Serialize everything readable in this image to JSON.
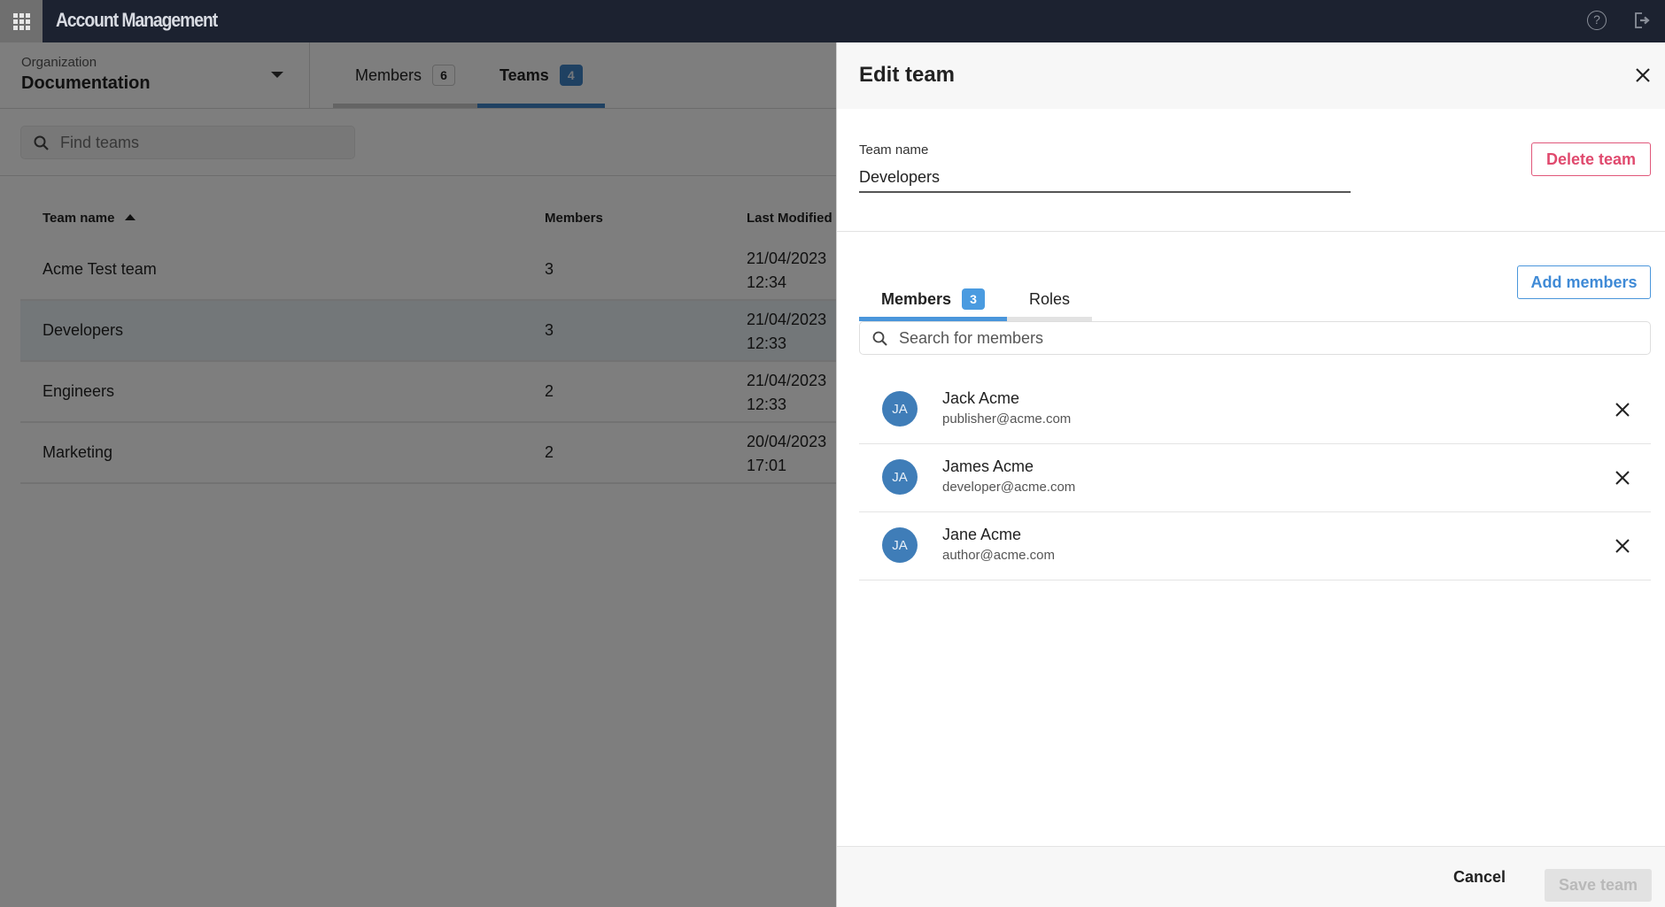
{
  "app": {
    "title": "Account Management",
    "icons": {
      "apps": "apps-grid-icon",
      "help": "help-icon",
      "logout": "logout-icon"
    },
    "help_glyph": "?"
  },
  "organization": {
    "label": "Organization",
    "value": "Documentation"
  },
  "main_tabs": [
    {
      "label": "Members",
      "count": "6",
      "active": false
    },
    {
      "label": "Teams",
      "count": "4",
      "active": true
    }
  ],
  "teams_search": {
    "placeholder": "Find teams",
    "value": ""
  },
  "teams_table": {
    "columns": [
      "Team name",
      "Members",
      "Last Modified"
    ],
    "sort": {
      "column": "Team name",
      "direction": "ascending"
    },
    "rows": [
      {
        "name": "Acme Test team",
        "members": "3",
        "date": "21/04/2023",
        "time": "12:34",
        "selected": false
      },
      {
        "name": "Developers",
        "members": "3",
        "date": "21/04/2023",
        "time": "12:33",
        "selected": true
      },
      {
        "name": "Engineers",
        "members": "2",
        "date": "21/04/2023",
        "time": "12:33",
        "selected": false
      },
      {
        "name": "Marketing",
        "members": "2",
        "date": "20/04/2023",
        "time": "17:01",
        "selected": false
      }
    ]
  },
  "drawer": {
    "title": "Edit team",
    "team_name_label": "Team name",
    "team_name_value": "Developers",
    "delete_label": "Delete team",
    "tabs": [
      {
        "label": "Members",
        "count": "3",
        "active": true
      },
      {
        "label": "Roles",
        "active": false
      }
    ],
    "add_members_label": "Add members",
    "member_search_placeholder": "Search for members",
    "members": [
      {
        "initials": "JA",
        "name": "Jack Acme",
        "email": "publisher@acme.com"
      },
      {
        "initials": "JA",
        "name": "James Acme",
        "email": "developer@acme.com"
      },
      {
        "initials": "JA",
        "name": "Jane Acme",
        "email": "author@acme.com"
      }
    ],
    "cancel_label": "Cancel",
    "save_label": "Save team",
    "save_enabled": false
  },
  "colors": {
    "topbar": "#1c2230",
    "accent": "#3f82c4",
    "danger": "#e04a6e",
    "avatar": "#3f7db8"
  }
}
